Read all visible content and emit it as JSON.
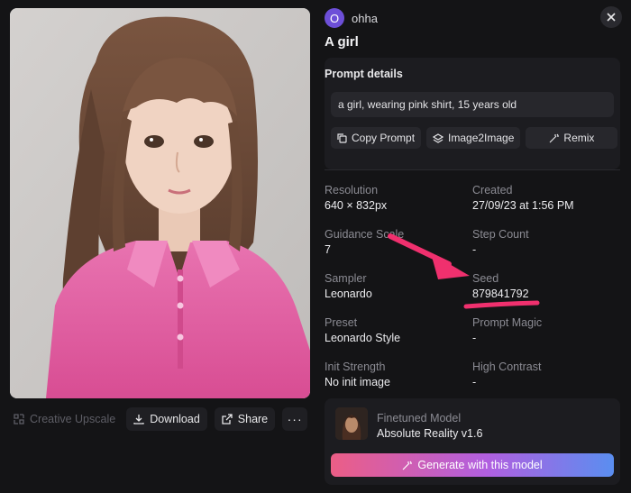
{
  "user": {
    "avatar_letter": "O",
    "name": "ohha"
  },
  "title": "A girl",
  "prompt": {
    "section_label": "Prompt details",
    "text": "a girl, wearing pink shirt, 15 years old",
    "copy_label": "Copy Prompt",
    "image2image_label": "Image2Image",
    "remix_label": "Remix"
  },
  "details": {
    "resolution_label": "Resolution",
    "resolution": "640 × 832px",
    "created_label": "Created",
    "created": "27/09/23 at 1:56 PM",
    "guidance_label": "Guidance Scale",
    "guidance": "7",
    "step_label": "Step Count",
    "step": "-",
    "sampler_label": "Sampler",
    "sampler": "Leonardo",
    "seed_label": "Seed",
    "seed": "879841792",
    "preset_label": "Preset",
    "preset": "Leonardo Style",
    "magic_label": "Prompt Magic",
    "magic": "-",
    "init_label": "Init Strength",
    "init": "No init image",
    "contrast_label": "High Contrast",
    "contrast": "-"
  },
  "model": {
    "section_label": "Finetuned Model",
    "name": "Absolute Reality v1.6",
    "generate_label": "Generate with this model"
  },
  "image_actions": {
    "upscale_label": "Creative Upscale",
    "download_label": "Download",
    "share_label": "Share",
    "more_label": "···"
  },
  "colors": {
    "background": "#141416",
    "card": "#1c1c20",
    "avatar": "#6d4fd8",
    "annotation": "#f0306e",
    "shirt": "#e35ca0"
  }
}
